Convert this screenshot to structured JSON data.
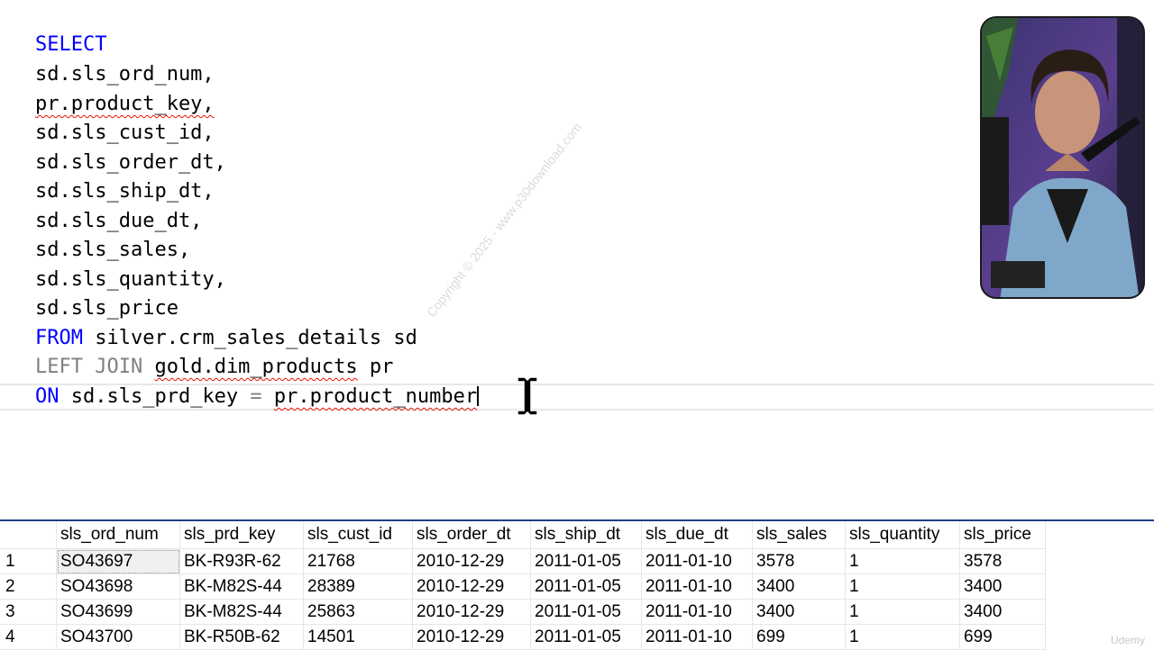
{
  "editor": {
    "lines": {
      "l1": {
        "kw": "SELECT"
      },
      "l2": {
        "text": "sd.sls_ord_num,"
      },
      "l3": {
        "text": "pr.product_key,"
      },
      "l4": {
        "text": "sd.sls_cust_id,"
      },
      "l5": {
        "text": "sd.sls_order_dt,"
      },
      "l6": {
        "text": "sd.sls_ship_dt,"
      },
      "l7": {
        "text": "sd.sls_due_dt,"
      },
      "l8": {
        "text": "sd.sls_sales,"
      },
      "l9": {
        "text": "sd.sls_quantity,"
      },
      "l10": {
        "text": "sd.sls_price"
      },
      "l11": {
        "kw": "FROM",
        "text": " silver.crm_sales_details sd"
      },
      "l12": {
        "kw": "LEFT JOIN",
        "sep": " ",
        "table": "gold.dim_products",
        "alias": " pr"
      },
      "l13": {
        "kw": "ON",
        "left": " sd.sls_prd_key ",
        "op": "=",
        "sep": " ",
        "right": "pr.product_number"
      }
    }
  },
  "watermark": "Copyright © 2025 - www.p30download.com",
  "results": {
    "columns": [
      "",
      "sls_ord_num",
      "sls_prd_key",
      "sls_cust_id",
      "sls_order_dt",
      "sls_ship_dt",
      "sls_due_dt",
      "sls_sales",
      "sls_quantity",
      "sls_price"
    ],
    "rows": [
      [
        "1",
        "SO43697",
        "BK-R93R-62",
        "21768",
        "2010-12-29",
        "2011-01-05",
        "2011-01-10",
        "3578",
        "1",
        "3578"
      ],
      [
        "2",
        "SO43698",
        "BK-M82S-44",
        "28389",
        "2010-12-29",
        "2011-01-05",
        "2011-01-10",
        "3400",
        "1",
        "3400"
      ],
      [
        "3",
        "SO43699",
        "BK-M82S-44",
        "25863",
        "2010-12-29",
        "2011-01-05",
        "2011-01-10",
        "3400",
        "1",
        "3400"
      ],
      [
        "4",
        "SO43700",
        "BK-R50B-62",
        "14501",
        "2010-12-29",
        "2011-01-05",
        "2011-01-10",
        "699",
        "1",
        "699"
      ]
    ]
  },
  "brand": "Udemy",
  "colors": {
    "keyword": "#0000ff",
    "squiggle": "#e51400",
    "grid_border": "#1f3d8a"
  }
}
